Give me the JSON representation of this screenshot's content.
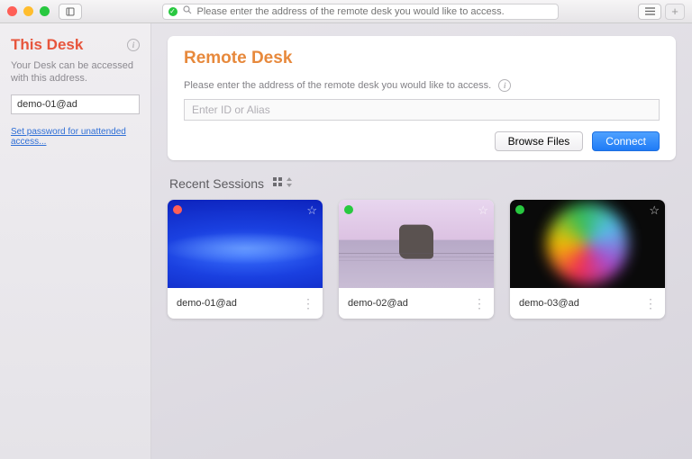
{
  "titlebar": {
    "search_placeholder": "Please enter the address of the remote desk you would like to access."
  },
  "sidebar": {
    "title": "This Desk",
    "desc": "Your Desk can be accessed with this address.",
    "address_value": "demo-01@ad",
    "link": "Set password for unattended access..."
  },
  "remote": {
    "title": "Remote Desk",
    "prompt": "Please enter the address of the remote desk you would like to access.",
    "input_placeholder": "Enter ID or Alias",
    "browse_label": "Browse Files",
    "connect_label": "Connect"
  },
  "recent": {
    "heading": "Recent Sessions",
    "sessions": [
      {
        "label": "demo-01@ad",
        "status_color": "#ff5f57"
      },
      {
        "label": "demo-02@ad",
        "status_color": "#28c840"
      },
      {
        "label": "demo-03@ad",
        "status_color": "#28c840"
      }
    ]
  }
}
